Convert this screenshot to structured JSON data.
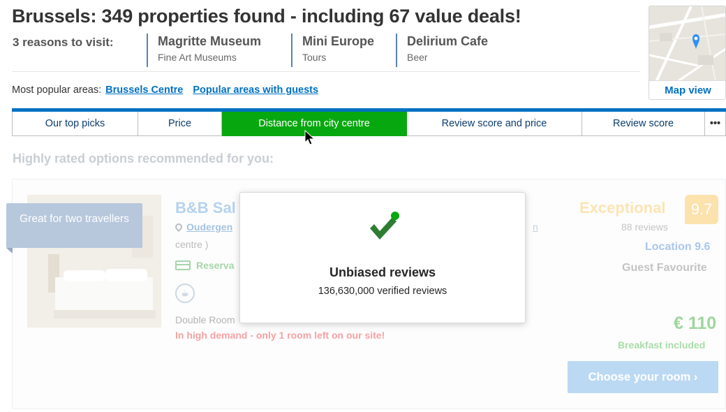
{
  "header": {
    "title": "Brussels: 349 properties found - including 67 value deals!",
    "reasons_label": "3 reasons to visit:",
    "reasons": [
      {
        "title": "Magritte Museum",
        "subtitle": "Fine Art Museums"
      },
      {
        "title": "Mini Europe",
        "subtitle": "Tours"
      },
      {
        "title": "Delirium Cafe",
        "subtitle": "Beer"
      }
    ],
    "popular_areas_label": "Most popular areas:",
    "popular_areas": [
      "Brussels Centre",
      "Popular areas with guests"
    ],
    "map_view_label": "Map view"
  },
  "sort_tabs": [
    {
      "label": "Our top picks",
      "active": false
    },
    {
      "label": "Price",
      "active": false
    },
    {
      "label": "Distance from city centre",
      "active": true
    },
    {
      "label": "Review score and price",
      "active": false
    },
    {
      "label": "Review score",
      "active": false
    },
    {
      "label": "•••",
      "active": false
    }
  ],
  "section_heading": "Highly rated options recommended for you:",
  "hotel_card": {
    "ribbon": "Great for two travellers",
    "name": "B&B Sal",
    "address": "Oudergen",
    "address_line_2": "centre )",
    "address_trailing": "n",
    "reservation": "Reserva",
    "room_type": "Double Room",
    "demand_notice": "In high demand - only 1 room left on our site!",
    "rating_word": "Exceptional",
    "rating_score": "9.7",
    "review_count": "88 reviews",
    "location_score": "Location 9.6",
    "guest_favourite": "Guest Favourite",
    "price": "€ 110",
    "breakfast": "Breakfast included",
    "choose_button": "Choose your room ›"
  },
  "modal": {
    "title": "Unbiased reviews",
    "subtitle": "136,630,000 verified reviews",
    "check_color": "#2e7d32",
    "dot_color": "#07a80f"
  },
  "colors": {
    "brand_blue": "#0071c2",
    "active_tab_green": "#07a80f"
  }
}
